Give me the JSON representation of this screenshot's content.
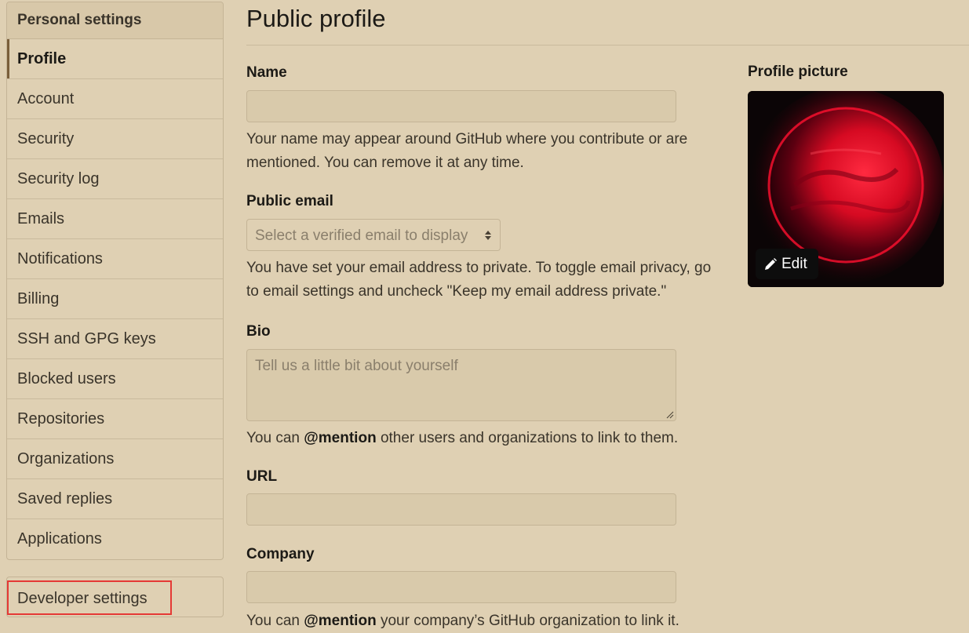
{
  "sidebar": {
    "header": "Personal settings",
    "items": [
      {
        "label": "Profile",
        "selected": true
      },
      {
        "label": "Account"
      },
      {
        "label": "Security"
      },
      {
        "label": "Security log"
      },
      {
        "label": "Emails"
      },
      {
        "label": "Notifications"
      },
      {
        "label": "Billing"
      },
      {
        "label": "SSH and GPG keys"
      },
      {
        "label": "Blocked users"
      },
      {
        "label": "Repositories"
      },
      {
        "label": "Organizations"
      },
      {
        "label": "Saved replies"
      },
      {
        "label": "Applications"
      }
    ],
    "developer_settings": "Developer settings"
  },
  "main": {
    "title": "Public profile",
    "name": {
      "label": "Name",
      "value": "",
      "help": "Your name may appear around GitHub where you contribute or are mentioned. You can remove it at any time."
    },
    "public_email": {
      "label": "Public email",
      "selected": "Select a verified email to display",
      "help": "You have set your email address to private. To toggle email privacy, go to email settings and uncheck \"Keep my email address private.\""
    },
    "bio": {
      "label": "Bio",
      "placeholder": "Tell us a little bit about yourself",
      "help_prefix": "You can ",
      "help_bold": "@mention",
      "help_suffix": " other users and organizations to link to them."
    },
    "url": {
      "label": "URL",
      "value": ""
    },
    "company": {
      "label": "Company",
      "value": "",
      "help_prefix": "You can ",
      "help_bold": "@mention",
      "help_suffix": " your company’s GitHub organization to link it."
    }
  },
  "profile_picture": {
    "label": "Profile picture",
    "edit_label": "Edit",
    "edit_icon": "pencil-icon"
  },
  "colors": {
    "background": "#dfd0b3",
    "highlight_box": "#e53935",
    "planet_red": "#ff1030"
  }
}
